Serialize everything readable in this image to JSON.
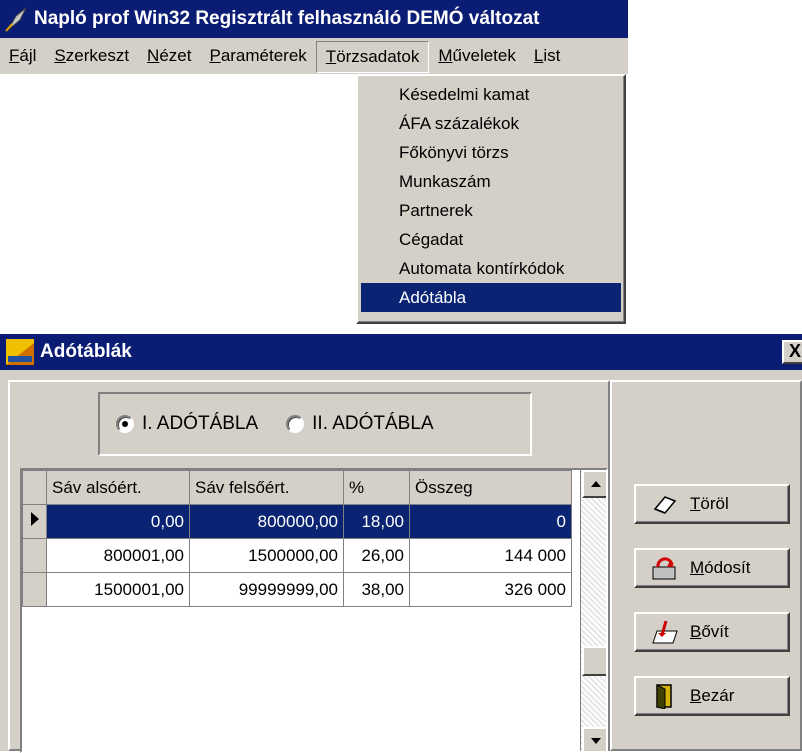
{
  "app": {
    "title": "Napló prof Win32 Regisztrált felhasználó  DEMÓ változat"
  },
  "menubar": {
    "items": [
      {
        "label": "Fájl",
        "u": "F",
        "rest": "ájl"
      },
      {
        "label": "Szerkeszt",
        "u": "S",
        "rest": "zerkeszt"
      },
      {
        "label": "Nézet",
        "u": "N",
        "rest": "ézet"
      },
      {
        "label": "Paraméterek",
        "u": "P",
        "rest": "araméterek"
      },
      {
        "label": "Törzsadatok",
        "u": "T",
        "rest": "örzsadatok"
      },
      {
        "label": "Műveletek",
        "u": "M",
        "rest": "űveletek"
      },
      {
        "label": "List",
        "u": "L",
        "rest": "ist"
      }
    ]
  },
  "dropdown": {
    "items": [
      "Késedelmi kamat",
      "ÁFA százalékok",
      "Főkönyvi törzs",
      "Munkaszám",
      "Partnerek",
      "Cégadat",
      "Automata kontírkódok",
      "Adótábla"
    ],
    "selected_index": 7
  },
  "dialog": {
    "title": "Adótáblák",
    "close_label": "X",
    "radios": [
      {
        "label": "I. ADÓTÁBLA",
        "checked": true
      },
      {
        "label": "II. ADÓTÁBLA",
        "checked": false
      }
    ],
    "columns": [
      "Sáv alsóért.",
      "Sáv felsőért.",
      "%",
      "Összeg"
    ],
    "rows": [
      [
        "0,00",
        "800000,00",
        "18,00",
        "0"
      ],
      [
        "800001,00",
        "1500000,00",
        "26,00",
        "144 000"
      ],
      [
        "1500001,00",
        "99999999,00",
        "38,00",
        "326 000"
      ]
    ],
    "selected_row": 0,
    "buttons": [
      {
        "label": "Töröl",
        "u": "T",
        "rest": "öröl",
        "icon": "eraser-icon"
      },
      {
        "label": "Módosít",
        "u": "M",
        "rest": "ódosít",
        "icon": "modify-icon"
      },
      {
        "label": "Bővít",
        "u": "B",
        "rest": "ővít",
        "icon": "add-icon"
      },
      {
        "label": "Bezár",
        "u": "B",
        "rest": "ezár",
        "icon": "door-icon"
      }
    ]
  },
  "colors": {
    "titlebar": "#0a1c73",
    "selection": "#0a2473",
    "face": "#d4d0c8"
  }
}
